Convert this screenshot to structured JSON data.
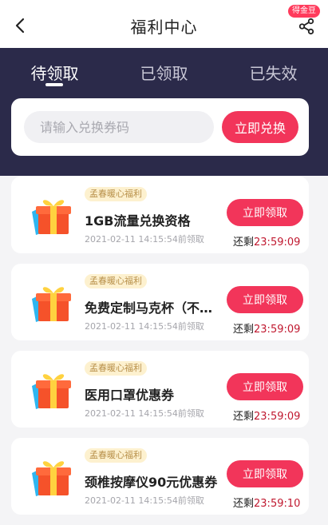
{
  "header": {
    "title": "福利中心",
    "badge": "得金豆",
    "back_icon": "chevron-left-icon",
    "share_icon": "share-icon"
  },
  "tabs": [
    {
      "label": "待领取",
      "active": true
    },
    {
      "label": "已领取",
      "active": false
    },
    {
      "label": "已失效",
      "active": false
    }
  ],
  "redeem": {
    "placeholder": "请输入兑换券码",
    "button": "立即兑换"
  },
  "colors": {
    "accent": "#f2355a",
    "header_band": "#2b2a4a",
    "tag_bg": "#fdf1cf",
    "countdown": "#c0182f"
  },
  "coupons": [
    {
      "tag": "孟春暖心福利",
      "name": "1GB流量兑换资格",
      "time": "2021-02-11 14:15:54前领取",
      "button": "立即领取",
      "remain_label": "还剩",
      "remain": "23:59:09",
      "icon": "gift-box-icon"
    },
    {
      "tag": "孟春暖心福利",
      "name": "免费定制马克杯（不…",
      "time": "2021-02-11 14:15:54前领取",
      "button": "立即领取",
      "remain_label": "还剩",
      "remain": "23:59:09",
      "icon": "gift-box-icon"
    },
    {
      "tag": "孟春暖心福利",
      "name": "医用口罩优惠券",
      "time": "2021-02-11 14:15:54前领取",
      "button": "立即领取",
      "remain_label": "还剩",
      "remain": "23:59:09",
      "icon": "gift-box-icon"
    },
    {
      "tag": "孟春暖心福利",
      "name": "颈椎按摩仪90元优惠券",
      "time": "2021-02-11 14:15:54前领取",
      "button": "立即领取",
      "remain_label": "还剩",
      "remain": "23:59:10",
      "icon": "gift-box-icon"
    }
  ]
}
